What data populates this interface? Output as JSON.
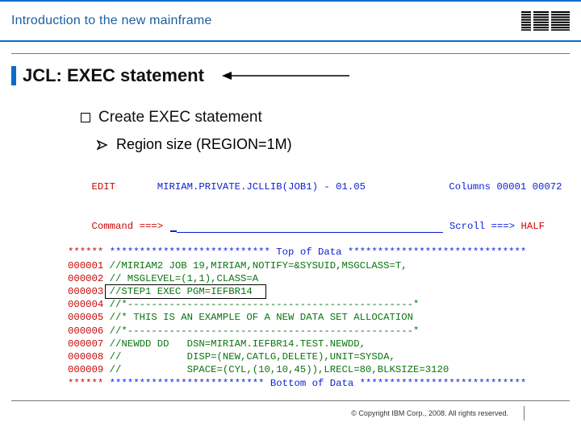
{
  "header": {
    "title": "Introduction to the new mainframe",
    "logo_text": "IBM"
  },
  "slide": {
    "title": "JCL: EXEC statement",
    "bullet_main": "Create EXEC statement",
    "bullet_sub": "Region size (REGION=1M)"
  },
  "terminal": {
    "edit_label": "EDIT",
    "dataset": "MIRIAM.PRIVATE.JCLLIB(JOB1) - 01.05",
    "columns_label": "Columns 00001 00072",
    "command_label": "Command ===>",
    "scroll_label": "Scroll ===>",
    "scroll_value": "HALF",
    "top_seq": "******",
    "top_stars_left": "***************************",
    "top_text": " Top of Data ",
    "top_stars_right": "******************************",
    "lines": [
      {
        "seq": "000001",
        "code": "//MIRIAM2 JOB 19,MIRIAM,NOTIFY=&SYSUID,MSGCLASS=T,"
      },
      {
        "seq": "000002",
        "code": "// MSGLEVEL=(1,1),CLASS=A"
      },
      {
        "seq": "000003",
        "code": "//STEP1 EXEC PGM=IEFBR14"
      },
      {
        "seq": "000004",
        "code": "//*------------------------------------------------*"
      },
      {
        "seq": "000005",
        "code": "//* THIS IS AN EXAMPLE OF A NEW DATA SET ALLOCATION"
      },
      {
        "seq": "000006",
        "code": "//*------------------------------------------------*"
      },
      {
        "seq": "000007",
        "code": "//NEWDD DD   DSN=MIRIAM.IEFBR14.TEST.NEWDD,"
      },
      {
        "seq": "000008",
        "code": "//           DISP=(NEW,CATLG,DELETE),UNIT=SYSDA,"
      },
      {
        "seq": "000009",
        "code": "//           SPACE=(CYL,(10,10,45)),LRECL=80,BLKSIZE=3120"
      }
    ],
    "bot_seq": "******",
    "bot_stars_left": "**************************",
    "bot_text": " Bottom of Data ",
    "bot_stars_right": "****************************"
  },
  "footer": {
    "copyright": "© Copyright IBM Corp., 2008. All rights reserved."
  }
}
